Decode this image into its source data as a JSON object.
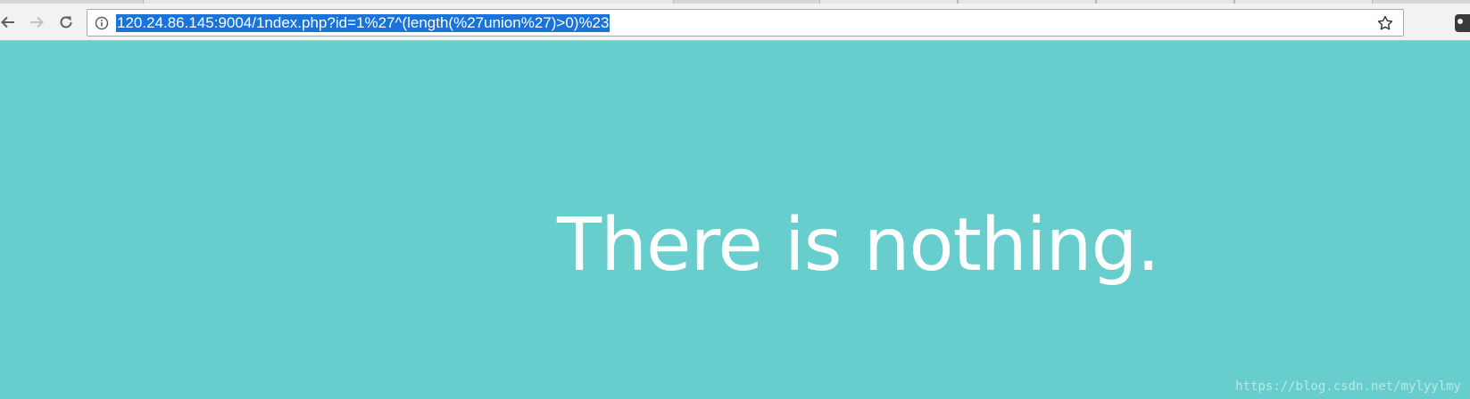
{
  "browser": {
    "url": "120.24.86.145:9004/1ndex.php?id=1%27^(length(%27union%27)>0)%23",
    "url_selected": true,
    "buttons": {
      "back": "back-arrow-icon",
      "forward": "forward-arrow-icon",
      "reload": "reload-icon",
      "info": "info-icon",
      "bookmark": "star-icon",
      "extension": "extension-icon"
    },
    "colors": {
      "selection": "#1a73d9",
      "toolbar": "#f2f2f2"
    }
  },
  "page": {
    "message": "There is nothing.",
    "background_color": "#68cdcd",
    "text_color": "#ffffff"
  },
  "watermark": {
    "text": "https://blog.csdn.net/mylyylmy"
  }
}
